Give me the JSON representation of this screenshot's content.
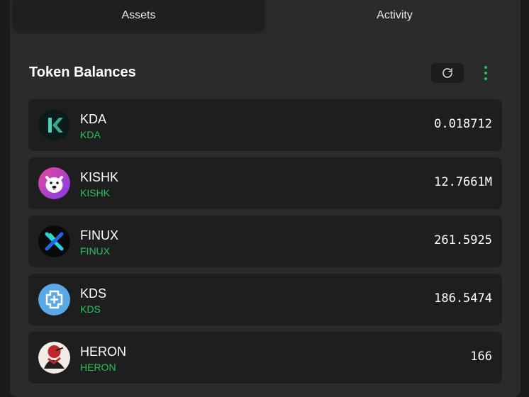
{
  "tabs": [
    {
      "label": "Assets",
      "active": true
    },
    {
      "label": "Activity",
      "active": false
    }
  ],
  "section": {
    "title": "Token Balances",
    "refresh_icon": "refresh-icon",
    "menu_icon": "more-vertical-icon"
  },
  "tokens": [
    {
      "name": "KDA",
      "symbol": "KDA",
      "balance": "0.018712",
      "logo": "kda-logo-icon"
    },
    {
      "name": "KISHK",
      "symbol": "KISHK",
      "balance": "12.7661M",
      "logo": "kishk-logo-icon"
    },
    {
      "name": "FINUX",
      "symbol": "FINUX",
      "balance": "261.5925",
      "logo": "finux-logo-icon"
    },
    {
      "name": "KDS",
      "symbol": "KDS",
      "balance": "186.5474",
      "logo": "kds-logo-icon"
    },
    {
      "name": "HERON",
      "symbol": "HERON",
      "balance": "166",
      "logo": "heron-logo-icon"
    }
  ],
  "colors": {
    "accent": "#22c55e",
    "panel": "#2b2b2b",
    "row": "#1e1e1e",
    "background": "#1b1b1b"
  }
}
